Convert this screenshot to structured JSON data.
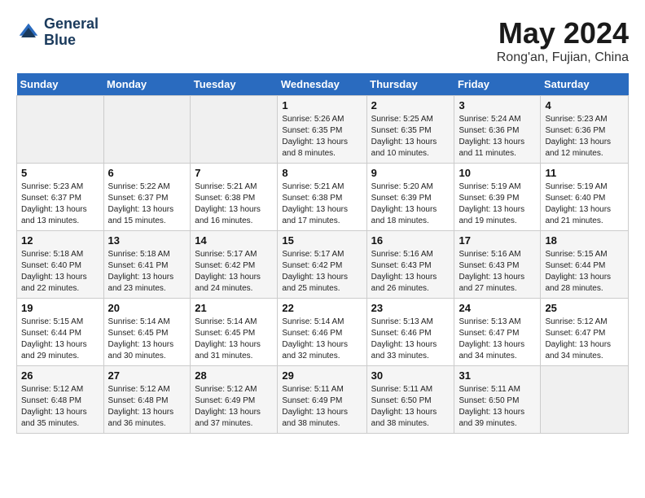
{
  "header": {
    "logo_line1": "General",
    "logo_line2": "Blue",
    "month": "May 2024",
    "location": "Rong'an, Fujian, China"
  },
  "days_of_week": [
    "Sunday",
    "Monday",
    "Tuesday",
    "Wednesday",
    "Thursday",
    "Friday",
    "Saturday"
  ],
  "weeks": [
    [
      {
        "day": "",
        "info": ""
      },
      {
        "day": "",
        "info": ""
      },
      {
        "day": "",
        "info": ""
      },
      {
        "day": "1",
        "info": "Sunrise: 5:26 AM\nSunset: 6:35 PM\nDaylight: 13 hours\nand 8 minutes."
      },
      {
        "day": "2",
        "info": "Sunrise: 5:25 AM\nSunset: 6:35 PM\nDaylight: 13 hours\nand 10 minutes."
      },
      {
        "day": "3",
        "info": "Sunrise: 5:24 AM\nSunset: 6:36 PM\nDaylight: 13 hours\nand 11 minutes."
      },
      {
        "day": "4",
        "info": "Sunrise: 5:23 AM\nSunset: 6:36 PM\nDaylight: 13 hours\nand 12 minutes."
      }
    ],
    [
      {
        "day": "5",
        "info": "Sunrise: 5:23 AM\nSunset: 6:37 PM\nDaylight: 13 hours\nand 13 minutes."
      },
      {
        "day": "6",
        "info": "Sunrise: 5:22 AM\nSunset: 6:37 PM\nDaylight: 13 hours\nand 15 minutes."
      },
      {
        "day": "7",
        "info": "Sunrise: 5:21 AM\nSunset: 6:38 PM\nDaylight: 13 hours\nand 16 minutes."
      },
      {
        "day": "8",
        "info": "Sunrise: 5:21 AM\nSunset: 6:38 PM\nDaylight: 13 hours\nand 17 minutes."
      },
      {
        "day": "9",
        "info": "Sunrise: 5:20 AM\nSunset: 6:39 PM\nDaylight: 13 hours\nand 18 minutes."
      },
      {
        "day": "10",
        "info": "Sunrise: 5:19 AM\nSunset: 6:39 PM\nDaylight: 13 hours\nand 19 minutes."
      },
      {
        "day": "11",
        "info": "Sunrise: 5:19 AM\nSunset: 6:40 PM\nDaylight: 13 hours\nand 21 minutes."
      }
    ],
    [
      {
        "day": "12",
        "info": "Sunrise: 5:18 AM\nSunset: 6:40 PM\nDaylight: 13 hours\nand 22 minutes."
      },
      {
        "day": "13",
        "info": "Sunrise: 5:18 AM\nSunset: 6:41 PM\nDaylight: 13 hours\nand 23 minutes."
      },
      {
        "day": "14",
        "info": "Sunrise: 5:17 AM\nSunset: 6:42 PM\nDaylight: 13 hours\nand 24 minutes."
      },
      {
        "day": "15",
        "info": "Sunrise: 5:17 AM\nSunset: 6:42 PM\nDaylight: 13 hours\nand 25 minutes."
      },
      {
        "day": "16",
        "info": "Sunrise: 5:16 AM\nSunset: 6:43 PM\nDaylight: 13 hours\nand 26 minutes."
      },
      {
        "day": "17",
        "info": "Sunrise: 5:16 AM\nSunset: 6:43 PM\nDaylight: 13 hours\nand 27 minutes."
      },
      {
        "day": "18",
        "info": "Sunrise: 5:15 AM\nSunset: 6:44 PM\nDaylight: 13 hours\nand 28 minutes."
      }
    ],
    [
      {
        "day": "19",
        "info": "Sunrise: 5:15 AM\nSunset: 6:44 PM\nDaylight: 13 hours\nand 29 minutes."
      },
      {
        "day": "20",
        "info": "Sunrise: 5:14 AM\nSunset: 6:45 PM\nDaylight: 13 hours\nand 30 minutes."
      },
      {
        "day": "21",
        "info": "Sunrise: 5:14 AM\nSunset: 6:45 PM\nDaylight: 13 hours\nand 31 minutes."
      },
      {
        "day": "22",
        "info": "Sunrise: 5:14 AM\nSunset: 6:46 PM\nDaylight: 13 hours\nand 32 minutes."
      },
      {
        "day": "23",
        "info": "Sunrise: 5:13 AM\nSunset: 6:46 PM\nDaylight: 13 hours\nand 33 minutes."
      },
      {
        "day": "24",
        "info": "Sunrise: 5:13 AM\nSunset: 6:47 PM\nDaylight: 13 hours\nand 34 minutes."
      },
      {
        "day": "25",
        "info": "Sunrise: 5:12 AM\nSunset: 6:47 PM\nDaylight: 13 hours\nand 34 minutes."
      }
    ],
    [
      {
        "day": "26",
        "info": "Sunrise: 5:12 AM\nSunset: 6:48 PM\nDaylight: 13 hours\nand 35 minutes."
      },
      {
        "day": "27",
        "info": "Sunrise: 5:12 AM\nSunset: 6:48 PM\nDaylight: 13 hours\nand 36 minutes."
      },
      {
        "day": "28",
        "info": "Sunrise: 5:12 AM\nSunset: 6:49 PM\nDaylight: 13 hours\nand 37 minutes."
      },
      {
        "day": "29",
        "info": "Sunrise: 5:11 AM\nSunset: 6:49 PM\nDaylight: 13 hours\nand 38 minutes."
      },
      {
        "day": "30",
        "info": "Sunrise: 5:11 AM\nSunset: 6:50 PM\nDaylight: 13 hours\nand 38 minutes."
      },
      {
        "day": "31",
        "info": "Sunrise: 5:11 AM\nSunset: 6:50 PM\nDaylight: 13 hours\nand 39 minutes."
      },
      {
        "day": "",
        "info": ""
      }
    ]
  ]
}
